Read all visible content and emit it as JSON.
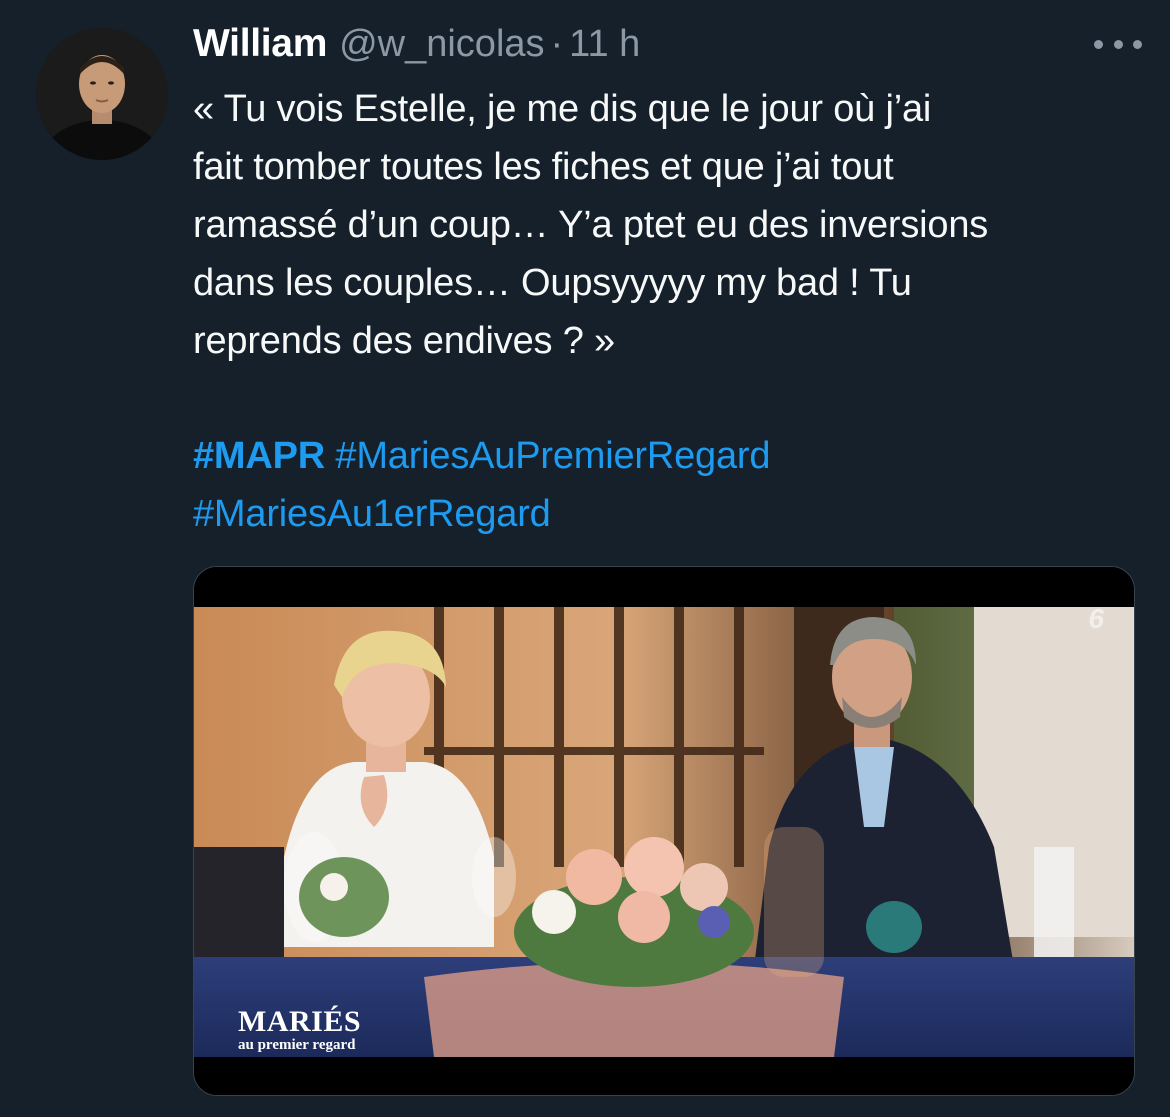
{
  "tweet": {
    "author": {
      "display_name": "William",
      "handle": "@w_nicolas",
      "avatar_icon": "person-avatar"
    },
    "separator": "·",
    "timestamp": "11 h",
    "more_icon": "ellipsis-icon",
    "text": "« Tu vois Estelle, je me dis que le jour où j’ai\nfait tomber toutes les fiches et que j’ai tout\nramassé d’un coup… Y’a ptet eu des inversions\ndans les couples… Oupsyyyyy my bad ! Tu\nreprends des endives ? »",
    "hashtags": [
      "#MAPR",
      "#MariesAuPremierRegard",
      "#MariesAu1erRegard"
    ],
    "media": {
      "overlay_title": "MARIÉS",
      "overlay_subtitle": "au premier regard",
      "channel_logo": "6"
    }
  },
  "colors": {
    "background": "#15202b",
    "text": "#f7f9f9",
    "secondary_text": "#8b98a5",
    "link": "#1d9bf0"
  }
}
